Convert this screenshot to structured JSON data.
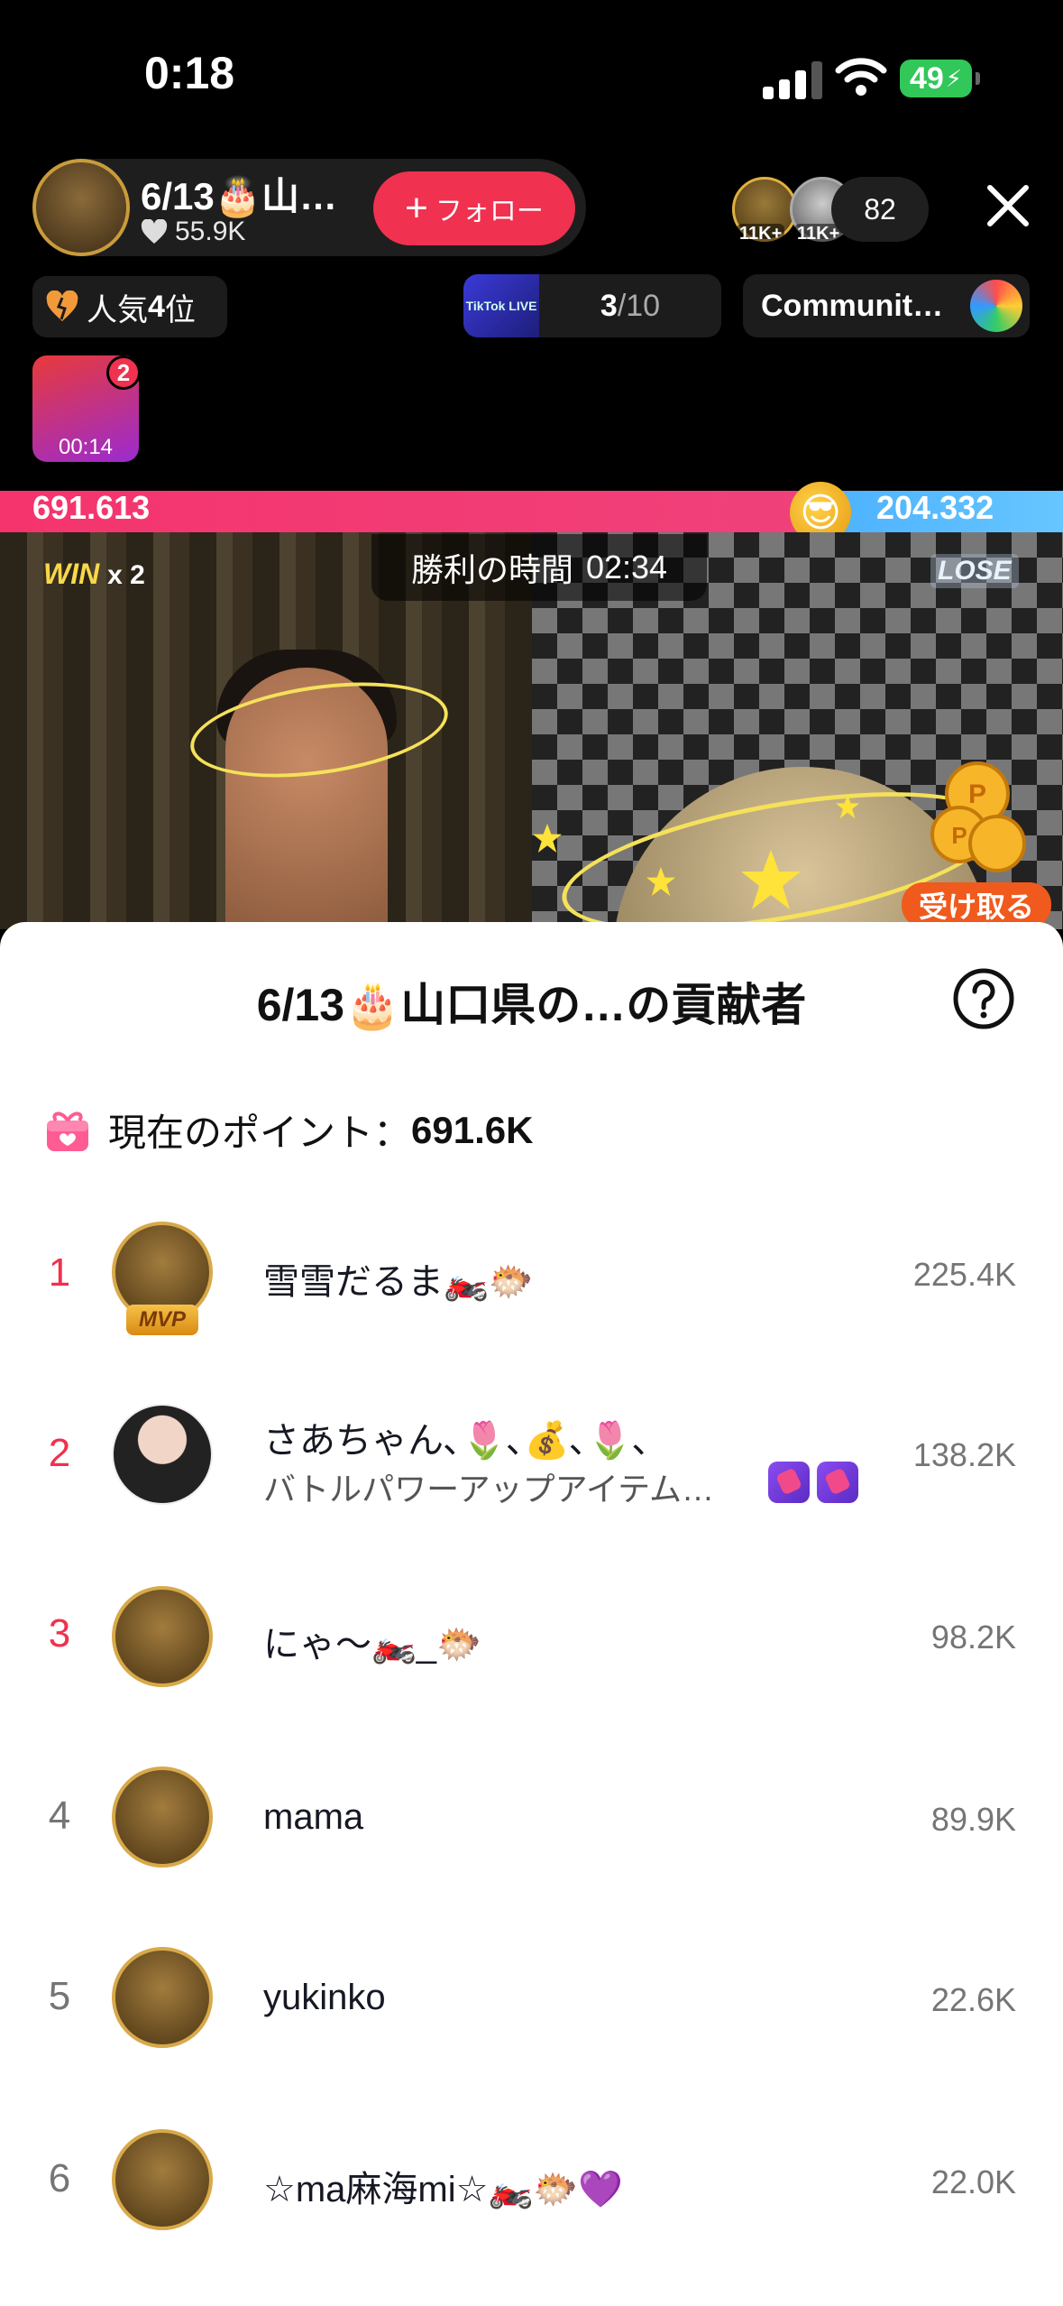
{
  "status_bar": {
    "time": "0:18",
    "battery": "49"
  },
  "host": {
    "name": "6/13🎂山…",
    "likes": "55.9K",
    "follow_label": "フォロー"
  },
  "viewers": {
    "badge1": "11K+",
    "badge2": "11K+",
    "count": "82"
  },
  "rank_pill": {
    "prefix": "人気",
    "rank": "4",
    "suffix": "位"
  },
  "tiktok_pill": {
    "icon_text": "TikTok LIVE",
    "progress_current": "3",
    "progress_total": "/10"
  },
  "community_pill": {
    "label": "Communit…"
  },
  "gift_box": {
    "badge": "2",
    "timer": "00:14"
  },
  "battle": {
    "left_score": "691.613",
    "right_score": "204.332",
    "win_label": "WIN",
    "win_count": "x 2",
    "lose_label": "LOSE",
    "timer_label": "勝利の時間",
    "timer_value": "02:34",
    "receive_label": "受け取る"
  },
  "sheet": {
    "title": "6/13🎂山口県の…の貢献者",
    "points_label": "現在のポイント：",
    "points_value": "691.6K",
    "contributors": [
      {
        "rank": "1",
        "name": "雪雪だるま🏍️🐡",
        "score": "225.4K",
        "badge": "MVP",
        "rank_color": "#f0314f"
      },
      {
        "rank": "2",
        "name": "さあちゃん､🌷､💰､🌷､",
        "sub": "バトルパワーアップアイテム…",
        "score": "138.2K",
        "rank_color": "#f0314f"
      },
      {
        "rank": "3",
        "name": "にゃ〜🏍️_🐡",
        "score": "98.2K",
        "rank_color": "#f0314f"
      },
      {
        "rank": "4",
        "name": "mama",
        "score": "89.9K",
        "rank_color": "#757575"
      },
      {
        "rank": "5",
        "name": "yukinko",
        "score": "22.6K",
        "rank_color": "#757575"
      },
      {
        "rank": "6",
        "name": "☆ma麻海mi☆🏍️🐡💜",
        "score": "22.0K",
        "rank_color": "#757575"
      }
    ]
  }
}
